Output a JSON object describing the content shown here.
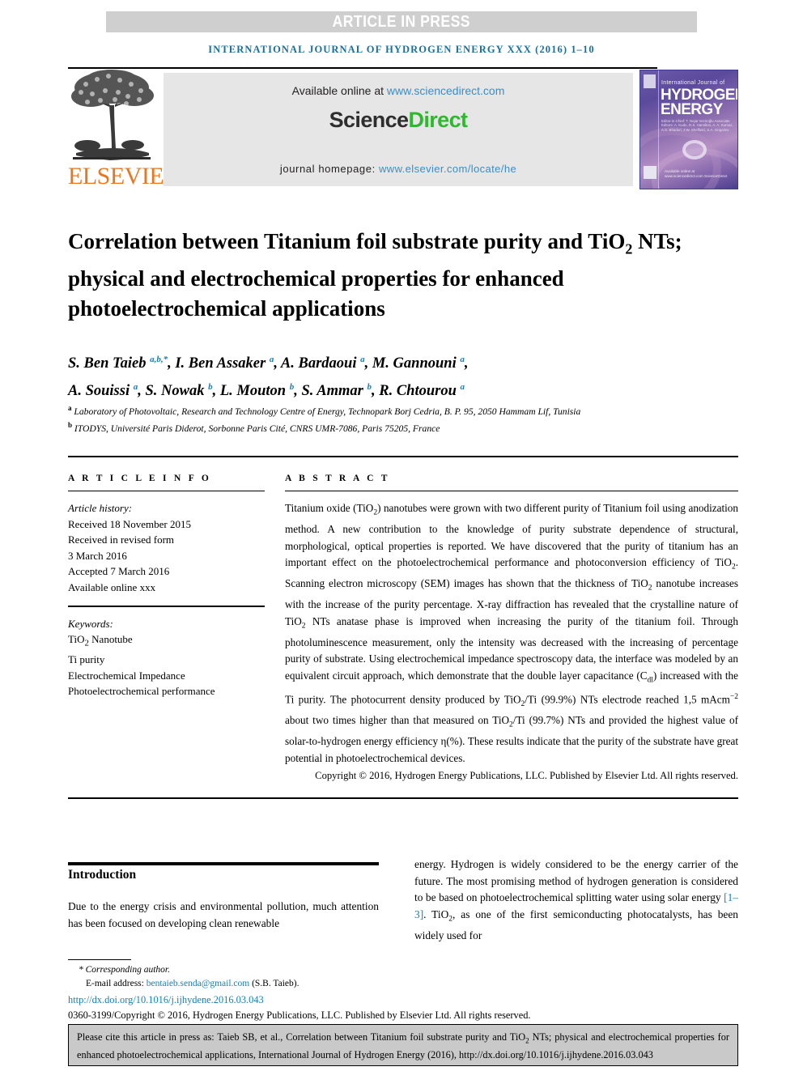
{
  "banner": {
    "article_in_press": "ARTICLE IN PRESS"
  },
  "running_head": "INTERNATIONAL JOURNAL OF HYDROGEN ENERGY XXX (2016) 1–10",
  "masthead": {
    "publisher": "ELSEVIER",
    "available_prefix": "Available online at ",
    "available_url": "www.sciencedirect.com",
    "sciencedirect_first": "Science",
    "sciencedirect_second": "Direct",
    "homepage_label": "journal homepage: ",
    "homepage_url": "www.elsevier.com/locate/he",
    "cover": {
      "line_small": "International Journal of",
      "line_big_1": "HYDROGEN",
      "line_big_2": "ENERGY",
      "editors": "Editor-in-Chief: T. Nejat Veziroğlu   Associate Editors: A. Kudo, D.S. Hamilton, A. A. Kurnaz, A.S. Bhaduri, J.W. Sheffield, S.A. Grigoriev",
      "sciencedirect_mark": "Available online at www.sciencedirect.com   ScienceDirect"
    }
  },
  "title": "Correlation between Titanium foil substrate purity and TiO2 NTs; physical and electrochemical properties for enhanced photoelectrochemical applications",
  "authors_line_1": "S. Ben Taieb a,b,*, I. Ben Assaker a, A. Bardaoui a, M. Gannouni a,",
  "authors_line_2": "A. Souissi a, S. Nowak b, L. Mouton b, S. Ammar b, R. Chtourou a",
  "affiliations": [
    "a Laboratory of Photovoltaic, Research and Technology Centre of Energy, Technopark Borj Cedria, B. P. 95, 2050 Hammam Lif, Tunisia",
    "b ITODYS, Université Paris Diderot, Sorbonne Paris Cité, CNRS UMR-7086, Paris 75205, France"
  ],
  "article_info": {
    "heading": "A R T I C L E   I N F O",
    "history_label": "Article history:",
    "history": [
      "Received 18 November 2015",
      "Received in revised form",
      "3 March 2016",
      "Accepted 7 March 2016",
      "Available online xxx"
    ],
    "keywords_label": "Keywords:",
    "keywords": [
      "TiO2 Nanotube",
      "Ti purity",
      "Electrochemical Impedance",
      "Photoelectrochemical performance"
    ]
  },
  "abstract": {
    "heading": "A B S T R A C T",
    "body": "Titanium oxide (TiO2) nanotubes were grown with two different purity of Titanium foil using anodization method. A new contribution to the knowledge of purity substrate dependence of structural, morphological, optical properties is reported. We have discovered that the purity of titanium has an important effect on the photoelectrochemical performance and photoconversion efficiency of TiO2. Scanning electron microscopy (SEM) images has shown that the thickness of TiO2 nanotube increases with the increase of the purity percentage. X-ray diffraction has revealed that the crystalline nature of TiO2 NTs anatase phase is improved when increasing the purity of the titanium foil. Through photoluminescence measurement, only the intensity was decreased with the increasing of percentage purity of substrate. Using electrochemical impedance spectroscopy data, the interface was modeled by an equivalent circuit approach, which demonstrate that the double layer capacitance (Cdl) increased with the Ti purity. The photocurrent density produced by TiO2/Ti (99.9%) NTs electrode reached 1,5 mAcm−2 about two times higher than that measured on TiO2/Ti (99.7%) NTs and provided the highest value of solar-to-hydrogen energy efficiency η(%). These results indicate that the purity of the substrate have great potential in photoelectrochemical devices.",
    "copyright": "Copyright © 2016, Hydrogen Energy Publications, LLC. Published by Elsevier Ltd. All rights reserved."
  },
  "introduction": {
    "heading": "Introduction",
    "left_paragraph": "Due to the energy crisis and environmental pollution, much attention has been focused on developing clean renewable",
    "right_paragraph_pre": "energy. Hydrogen is widely considered to be the energy carrier of the future. The most promising method of hydrogen generation is considered to be based on photoelectrochemical splitting water using solar energy ",
    "reference": "[1–3]",
    "right_paragraph_post": ". TiO2, as one of the first semiconducting photocatalysts, has been widely used for"
  },
  "footnotes": {
    "corresponding": "* Corresponding author.",
    "email_label": "E-mail address: ",
    "email": "bentaieb.senda@gmail.com",
    "email_suffix": " (S.B. Taieb).",
    "doi": "http://dx.doi.org/10.1016/j.ijhydene.2016.03.043",
    "issn_line": "0360-3199/Copyright © 2016, Hydrogen Energy Publications, LLC. Published by Elsevier Ltd. All rights reserved."
  },
  "cite_box": "Please cite this article in press as: Taieb SB, et al., Correlation between Titanium foil substrate purity and TiO2 NTs; physical and electrochemical properties for enhanced photoelectrochemical applications, International Journal of Hydrogen Energy (2016), http://dx.doi.org/10.1016/j.ijhydene.2016.03.043",
  "colors": {
    "journal_blue": "#1a6f9a",
    "link_blue": "#1a7fb5",
    "sciencedirect_green": "#2eb82e",
    "elsevier_orange": "#E87722",
    "banner_gray": "#cfcfcf",
    "panel_gray": "#e6e6e6",
    "cite_gray": "#c9c9c9"
  }
}
